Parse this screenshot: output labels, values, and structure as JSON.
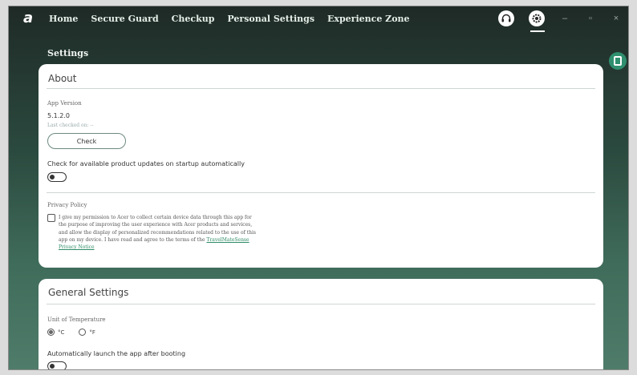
{
  "app": {
    "logo_letter": "a"
  },
  "nav": {
    "items": [
      {
        "label": "Home"
      },
      {
        "label": "Secure Guard"
      },
      {
        "label": "Checkup"
      },
      {
        "label": "Personal Settings"
      },
      {
        "label": "Experience Zone"
      }
    ]
  },
  "window_controls": {
    "minimize": "–",
    "restore": "▫",
    "close": "×"
  },
  "page": {
    "title": "Settings"
  },
  "about": {
    "title": "About",
    "app_version_label": "App Version",
    "app_version_value": "5.1.2.0",
    "last_checked": "Last checked on: --",
    "check_button": "Check",
    "auto_update_label": "Check for available product updates on startup automatically",
    "auto_update_enabled": false,
    "privacy_title": "Privacy Policy",
    "privacy_checked": false,
    "privacy_text": "I give my permission to Acer to collect certain device data through this app for the purpose of improving the user experience with Acer products and services, and allow the display of personalized recommendations related to the use of this app on my device. I have read and agree to the terms of the",
    "privacy_link": "TravelMateSense Privacy Notice"
  },
  "general": {
    "title": "General Settings",
    "temp_unit_label": "Unit of Temperature",
    "temp_options": [
      {
        "label": "°C",
        "selected": true
      },
      {
        "label": "°F",
        "selected": false
      }
    ],
    "auto_launch_label": "Automatically launch the app after booting",
    "auto_launch_enabled": false
  },
  "colors": {
    "accent": "#2f8f6f",
    "card_bg": "#ffffff"
  },
  "icons": [
    "headset-icon",
    "settings-icon",
    "side-panel-icon"
  ]
}
